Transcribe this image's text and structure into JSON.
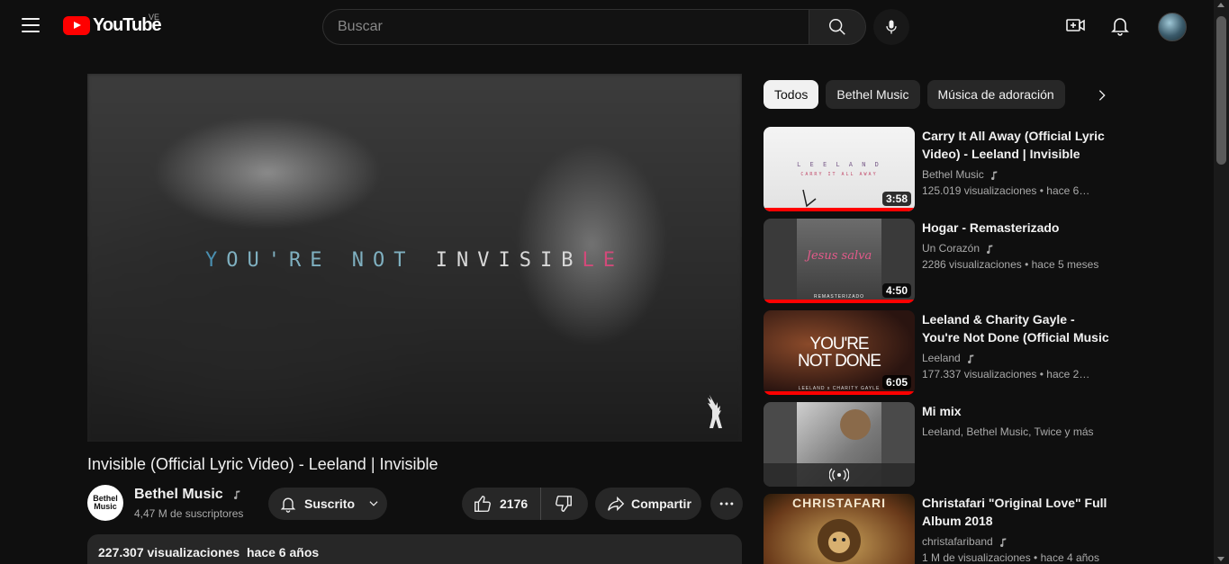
{
  "header": {
    "logo_text": "YouTube",
    "country": "VE",
    "search_placeholder": "Buscar"
  },
  "video": {
    "overlay_parts": [
      "Y",
      "OU'RE ",
      "NOT ",
      "INVISIB",
      "LE"
    ],
    "title": "Invisible (Official Lyric Video) - Leeland | Invisible",
    "channel": {
      "avatar_text_1": "Bethel",
      "avatar_text_2": "Music",
      "name": "Bethel Music",
      "subscribers": "4,47 M de suscriptores"
    },
    "subscribe_label": "Suscrito",
    "likes": "2176",
    "share_label": "Compartir",
    "views": "227.307 visualizaciones",
    "age": "hace 6 años"
  },
  "chips": [
    "Todos",
    "Bethel Music",
    "Música de adoración"
  ],
  "recommendations": [
    {
      "title": "Carry It All Away (Official Lyric Video) - Leeland | Invisible",
      "channel": "Bethel Music",
      "meta": "125.019 visualizaciones  • hace 6…",
      "duration": "3:58",
      "thumb_text_1": "L E E L A N D",
      "thumb_text_2": "CARRY IT ALL AWAY",
      "progress": 1.0
    },
    {
      "title": "Hogar - Remasterizado",
      "channel": "Un Corazón",
      "meta": "2286 visualizaciones  • hace 5 meses",
      "duration": "4:50",
      "thumb_text_1": "Jesus salva",
      "thumb_text_2": "REMASTERIZADO",
      "progress": 1.0
    },
    {
      "title": "Leeland & Charity Gayle - You're Not Done (Official Music Video)",
      "channel": "Leeland",
      "meta": "177.337 visualizaciones  • hace 2…",
      "duration": "6:05",
      "thumb_text_1": "YOU'RE",
      "thumb_text_2": "NOT DONE",
      "thumb_text_3": "LEELAND x CHARITY GAYLE",
      "progress": 1.0
    },
    {
      "title": "Mi mix",
      "meta": "Leeland, Bethel Music, Twice y más"
    },
    {
      "title": "Christafari \"Original Love\" Full Album 2018",
      "channel": "christafariband",
      "meta": "1 M de visualizaciones  • hace 4 años",
      "thumb_text_1": "CHRISTAFARI"
    }
  ]
}
